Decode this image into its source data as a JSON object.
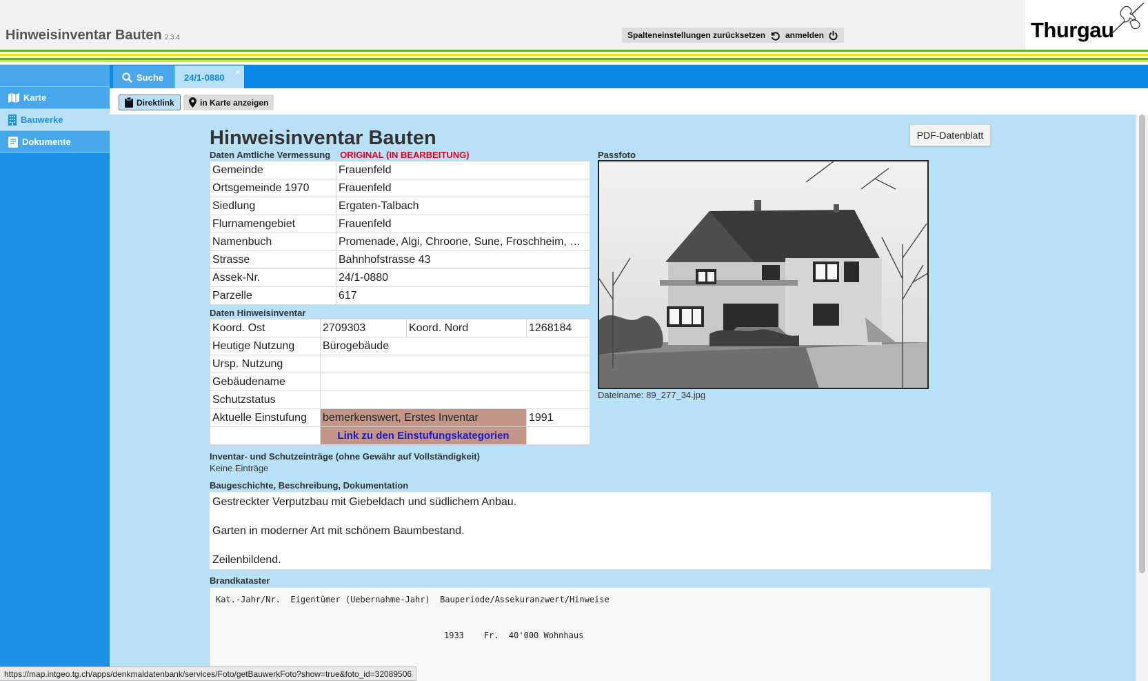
{
  "app": {
    "title": "Hinweisinventar Bauten",
    "version": "2.3.4"
  },
  "header": {
    "reset_label": "Spalteneinstellungen zurücksetzen",
    "login_label": "anmelden",
    "logo_text": "Thurgau"
  },
  "colors": {
    "stripe_green": "#5fae32",
    "stripe_yellow": "#f3e000",
    "accent_blue": "#0b89e8",
    "einstufung_bg": "#c49589"
  },
  "sidebar": {
    "items": [
      {
        "label": "Karte",
        "icon": "map-icon"
      },
      {
        "label": "Bauwerke",
        "icon": "building-icon",
        "active": true
      },
      {
        "label": "Dokumente",
        "icon": "document-icon"
      }
    ]
  },
  "tabs": {
    "search_label": "Suche",
    "active_label": "24/1-0880",
    "close_glyph": "×"
  },
  "toolbar": {
    "direktlink_label": "Direktlink",
    "karte_label": "in Karte anzeigen"
  },
  "page": {
    "title": "Hinweisinventar Bauten",
    "pdf_label": "PDF-Datenblatt"
  },
  "amtliche": {
    "label": "Daten Amtliche Vermessung",
    "status": "ORIGINAL (IN BEARBEITUNG)",
    "rows": [
      {
        "k": "Gemeinde",
        "v": "Frauenfeld"
      },
      {
        "k": "Ortsgemeinde 1970",
        "v": "Frauenfeld"
      },
      {
        "k": "Siedlung",
        "v": "Ergaten-Talbach"
      },
      {
        "k": "Flurnamengebiet",
        "v": "Frauenfeld"
      },
      {
        "k": "Namenbuch",
        "v": "Promenade, Algi, Chroone, Sune, Froschheim, Hoo…"
      },
      {
        "k": "Strasse",
        "v": "Bahnhofstrasse 43"
      },
      {
        "k": "Assek-Nr.",
        "v": "24/1-0880"
      },
      {
        "k": "Parzelle",
        "v": "617"
      }
    ]
  },
  "hinweis": {
    "label": "Daten Hinweisinventar",
    "koord_ost_label": "Koord. Ost",
    "koord_ost": "2709303",
    "koord_nord_label": "Koord. Nord",
    "koord_nord": "1268184",
    "heutige_label": "Heutige Nutzung",
    "heutige": "Bürogebäude",
    "ursp_label": "Ursp. Nutzung",
    "ursp": "",
    "gebname_label": "Gebäudename",
    "gebname": "",
    "schutz_label": "Schutzstatus",
    "schutz": "",
    "einstufung_label": "Aktuelle Einstufung",
    "einstufung": "bemerkenswert, Erstes Inventar",
    "einstufung_year": "1991",
    "link_label": "Link zu den Einstufungskategorien"
  },
  "passfoto": {
    "label": "Passfoto",
    "caption": "Dateiname: 89_277_34.jpg"
  },
  "inventar": {
    "label": "Inventar- und Schutzeinträge (ohne Gewähr auf Vollständigkeit)",
    "value": "Keine Einträge"
  },
  "baugeschichte": {
    "label": "Baugeschichte, Beschreibung, Dokumentation",
    "lines": [
      "Gestreckter Verputzbau mit Giebeldach und südlichem Anbau.",
      "Garten in moderner Art mit schönem Baumbestand.",
      "Zeilenbildend."
    ]
  },
  "brandkataster": {
    "label": "Brandkataster",
    "header": "Kat.-Jahr/Nr.  Eigentümer (Uebernahme-Jahr)  Bauperiode/Assekuranzwert/Hinweise",
    "row": "1933    Fr.  40'000 Wohnhaus"
  },
  "statusbar": {
    "url": "https://map.intgeo.tg.ch/apps/denkmaldatenbank/services/Foto/getBauwerkFoto?show=true&foto_id=32089506"
  }
}
